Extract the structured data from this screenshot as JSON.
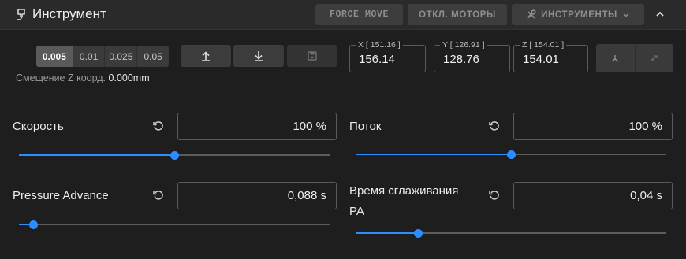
{
  "header": {
    "title": "Инструмент",
    "buttons": {
      "force_move": "FORCE_MOVE",
      "motors_off": "ОТКЛ. МОТОРЫ",
      "tools": "ИНСТРУМЕНТЫ"
    }
  },
  "move": {
    "steps": [
      "0.005",
      "0.01",
      "0.025",
      "0.05"
    ],
    "active_step": "0.005",
    "z_offset_label": "Смещение Z коорд.",
    "z_offset_value": "0.000mm"
  },
  "coords": {
    "x": {
      "legend": "X [ 151.16 ]",
      "value": "156.14"
    },
    "y": {
      "legend": "Y [ 126.91 ]",
      "value": "128.76"
    },
    "z": {
      "legend": "Z [ 154.01 ]",
      "value": "154.01"
    }
  },
  "speed": {
    "label": "Скорость",
    "value": "100 %",
    "level": 0.5
  },
  "flow": {
    "label": "Поток",
    "value": "100 %",
    "level": 0.5
  },
  "pressure_advance": {
    "label": "Pressure Advance",
    "value": "0,088 s",
    "level": 0.045
  },
  "smooth_time": {
    "label_line1": "Время сглаживания",
    "label_line2": "PA",
    "value": "0,04 s",
    "level": 0.2
  },
  "colors": {
    "accent": "#2f8cff",
    "background": "#1e1e1e",
    "header": "#2a2a2a"
  }
}
